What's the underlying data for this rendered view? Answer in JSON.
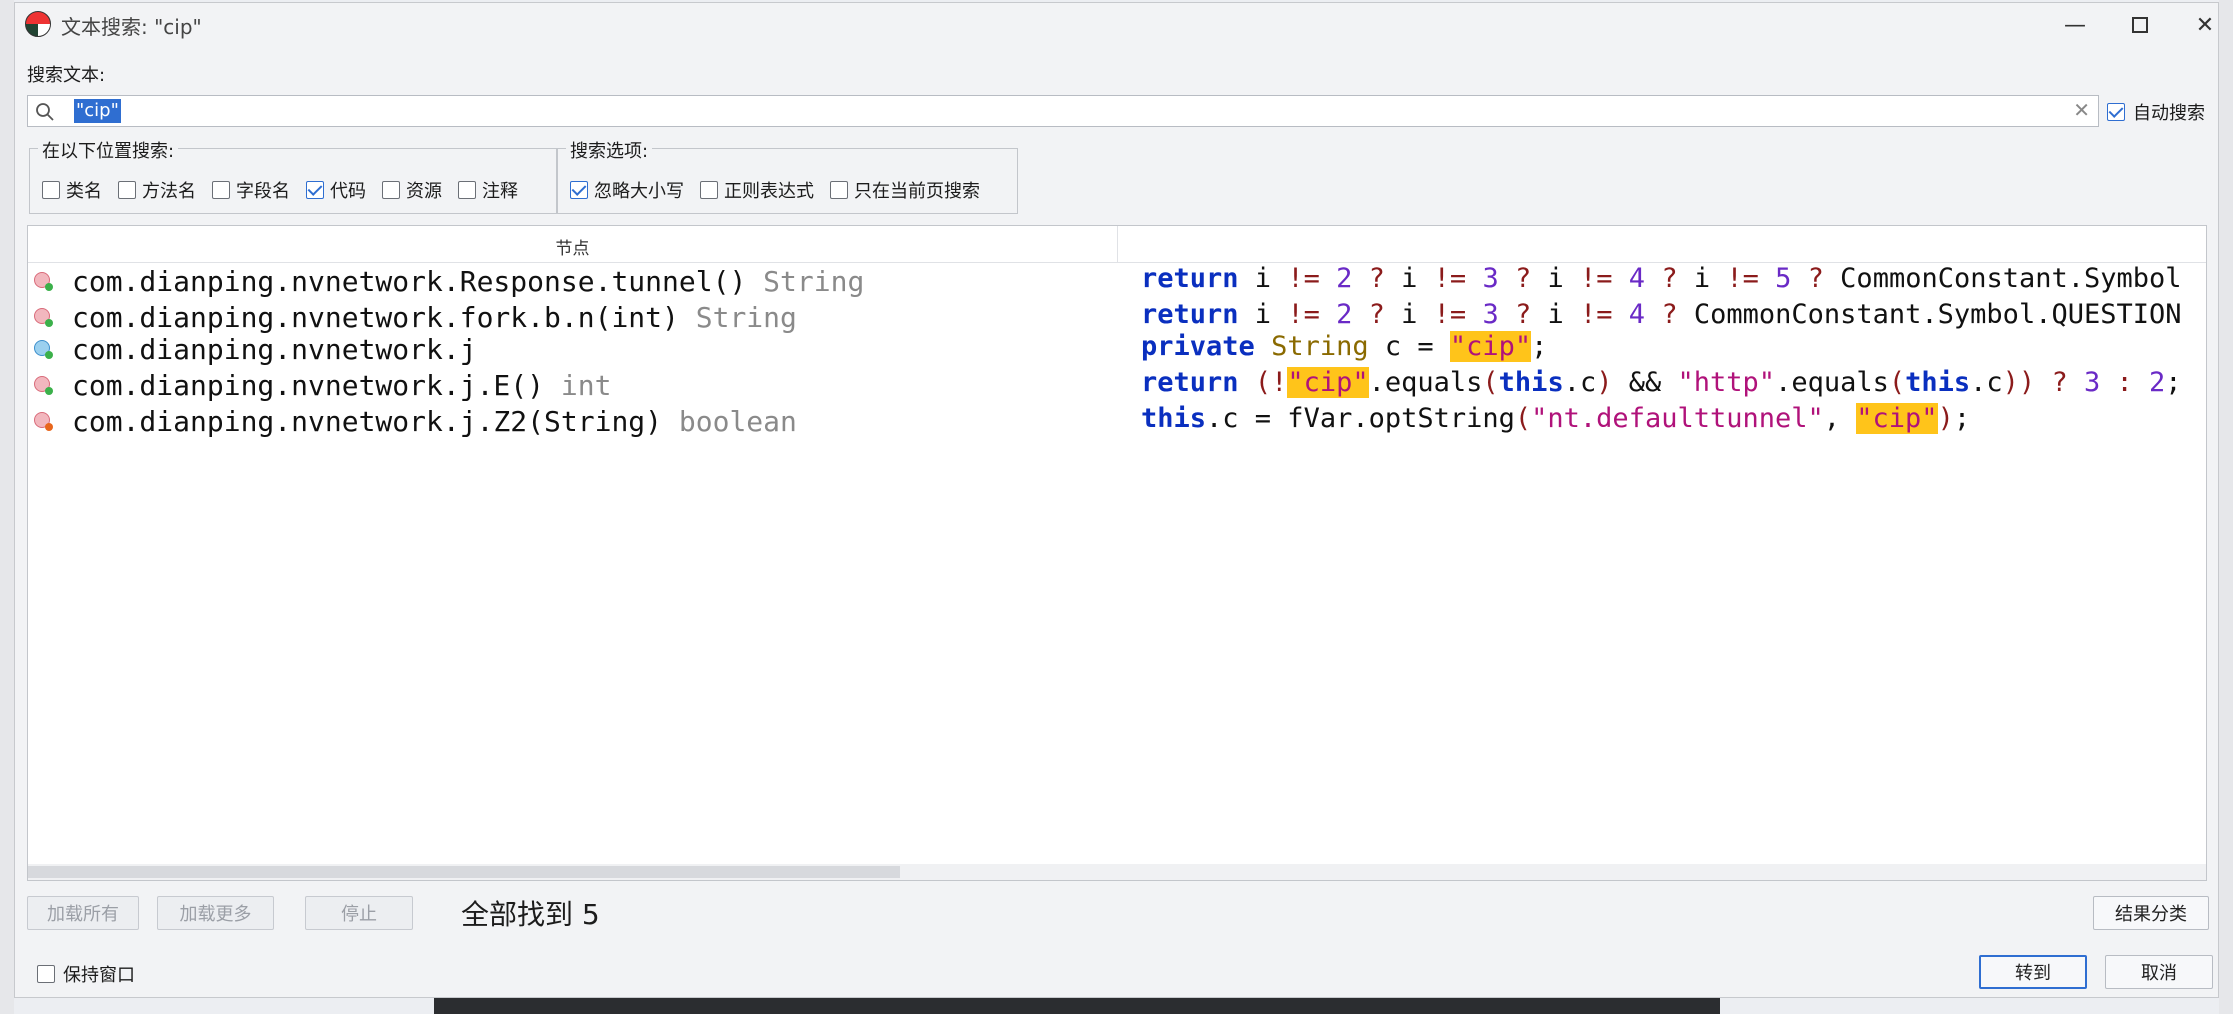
{
  "window": {
    "title": "文本搜索: \"cip\""
  },
  "search": {
    "label": "搜索文本:",
    "value": "\"cip\"",
    "auto_search_label": "自动搜索",
    "auto_search_checked": true
  },
  "locations": {
    "title": "在以下位置搜索:",
    "items": [
      {
        "label": "类名",
        "checked": false
      },
      {
        "label": "方法名",
        "checked": false
      },
      {
        "label": "字段名",
        "checked": false
      },
      {
        "label": "代码",
        "checked": true
      },
      {
        "label": "资源",
        "checked": false
      },
      {
        "label": "注释",
        "checked": false
      }
    ]
  },
  "options": {
    "title": "搜索选项:",
    "items": [
      {
        "label": "忽略大小写",
        "checked": true
      },
      {
        "label": "正则表达式",
        "checked": false
      },
      {
        "label": "只在当前页搜索",
        "checked": false
      }
    ]
  },
  "results": {
    "column_node": "节点",
    "rows": [
      {
        "icon": "method-icon",
        "node": "com.dianping.nvnetwork.Response.tunnel()",
        "type": "String"
      },
      {
        "icon": "method-icon",
        "node": "com.dianping.nvnetwork.fork.b.n(int)",
        "type": "String"
      },
      {
        "icon": "class-icon",
        "node": "com.dianping.nvnetwork.j",
        "type": ""
      },
      {
        "icon": "method-icon",
        "node": "com.dianping.nvnetwork.j.E()",
        "type": "int"
      },
      {
        "icon": "method-icon",
        "node": "com.dianping.nvnetwork.j.Z2(String)",
        "type": "boolean"
      }
    ],
    "code": [
      [
        [
          "kw",
          "return"
        ],
        [
          "",
          "  i "
        ],
        [
          "op",
          "!="
        ],
        [
          "",
          ""
        ],
        [
          "num",
          " 2 "
        ],
        [
          "op",
          "?"
        ],
        [
          "",
          " i "
        ],
        [
          "op",
          "!="
        ],
        [
          "num",
          " 3 "
        ],
        [
          "op",
          "?"
        ],
        [
          "",
          " i "
        ],
        [
          "op",
          "!="
        ],
        [
          "num",
          " 4 "
        ],
        [
          "op",
          "?"
        ],
        [
          "",
          " i "
        ],
        [
          "op",
          "!="
        ],
        [
          "num",
          " 5 "
        ],
        [
          "op",
          "?"
        ],
        [
          "",
          " CommonConstant.Symbol"
        ]
      ],
      [
        [
          "kw",
          "return"
        ],
        [
          "",
          "  i "
        ],
        [
          "op",
          "!="
        ],
        [
          "num",
          " 2 "
        ],
        [
          "op",
          "?"
        ],
        [
          "",
          " i "
        ],
        [
          "op",
          "!="
        ],
        [
          "num",
          " 3 "
        ],
        [
          "op",
          "?"
        ],
        [
          "",
          " i "
        ],
        [
          "op",
          "!="
        ],
        [
          "num",
          " 4 "
        ],
        [
          "op",
          "?"
        ],
        [
          "",
          " CommonConstant.Symbol.QUESTION"
        ]
      ],
      [
        [
          "kw",
          "private"
        ],
        [
          "",
          " "
        ],
        [
          "typ",
          "String"
        ],
        [
          "",
          " c = "
        ],
        [
          "hl",
          "\"cip\""
        ],
        [
          "",
          ";"
        ]
      ],
      [
        [
          "kw",
          "return"
        ],
        [
          "",
          " "
        ],
        [
          "op",
          "(!"
        ],
        [
          "hl",
          "\"cip\""
        ],
        [
          "",
          ".equals"
        ],
        [
          "op",
          "("
        ],
        [
          "kw",
          "this"
        ],
        [
          "",
          ".c"
        ],
        [
          "op",
          ")"
        ],
        [
          "",
          " && "
        ],
        [
          "str",
          "\"http\""
        ],
        [
          "",
          ".equals"
        ],
        [
          "op",
          "("
        ],
        [
          "kw",
          "this"
        ],
        [
          "",
          ".c"
        ],
        [
          "op",
          "))"
        ],
        [
          "",
          " "
        ],
        [
          "op",
          "?"
        ],
        [
          "num",
          " 3 "
        ],
        [
          "op",
          ":"
        ],
        [
          "num",
          " 2"
        ],
        [
          "",
          ";"
        ]
      ],
      [
        [
          "kw",
          "this"
        ],
        [
          "",
          ".c = fVar.optString"
        ],
        [
          "op",
          "("
        ],
        [
          "str",
          "\"nt.defaulttunnel\""
        ],
        [
          "",
          ", "
        ],
        [
          "hl",
          "\"cip\""
        ],
        [
          "op",
          ")"
        ],
        [
          "",
          ";"
        ]
      ]
    ]
  },
  "footer": {
    "load_all": "加载所有",
    "load_more": "加载更多",
    "stop": "停止",
    "found_text": "全部找到 5",
    "classify": "结果分类",
    "keep_window": "保持窗口",
    "goto": "转到",
    "cancel": "取消"
  }
}
